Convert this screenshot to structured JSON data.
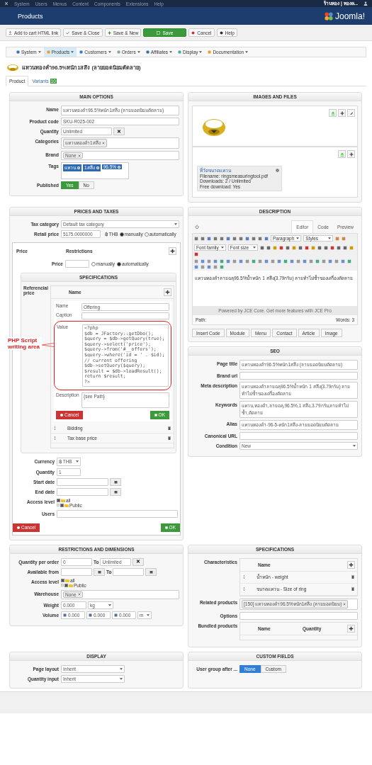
{
  "top_menu": [
    "System",
    "Users",
    "Menus",
    "Content",
    "Components",
    "Extensions",
    "Help"
  ],
  "user_menu": "ร้านทอง | ทองค...",
  "header": {
    "title": "Products",
    "logo": "Joomla!"
  },
  "toolbar": [
    {
      "label": "Add to cart HTML link",
      "kind": "default"
    },
    {
      "label": "Save & Close",
      "kind": "default"
    },
    {
      "label": "Save & New",
      "kind": "default"
    },
    {
      "label": "Save",
      "kind": "primary"
    },
    {
      "label": "Cancel",
      "kind": "default"
    },
    {
      "label": "Help",
      "kind": "default"
    }
  ],
  "component_menu": [
    {
      "label": "System",
      "selected": false
    },
    {
      "label": "Products",
      "selected": true
    },
    {
      "label": "Customers",
      "selected": false
    },
    {
      "label": "Orders",
      "selected": false
    },
    {
      "label": "Affiliates",
      "selected": false
    },
    {
      "label": "Display",
      "selected": false
    },
    {
      "label": "Documentation",
      "selected": false
    }
  ],
  "product_title": "แหวนทองคำ96.5%หนัก1สลึง (ลายยอดนิยมตัดลาย)",
  "tabs": [
    {
      "label": "Product",
      "selected": true
    },
    {
      "label": "Variants",
      "badge": "10",
      "selected": false
    }
  ],
  "rows": [
    {
      "left": [
        {
          "kind": "form",
          "title": "MAIN OPTIONS",
          "fields": [
            {
              "kind": "text",
              "label": "Name",
              "value": "แหวนทองคำ96.5%หนัก1สลึง (ลายยอดนิยมตัดลาย)"
            },
            {
              "kind": "text",
              "label": "Product code",
              "value": "SKU-R025-002"
            },
            {
              "kind": "clearable",
              "label": "Quantity",
              "value": "Unlimited",
              "button": "✕"
            },
            {
              "kind": "chips",
              "label": "Categories",
              "chips": [
                "แหวนทองคำ1สลึง"
              ]
            },
            {
              "kind": "chips",
              "label": "Brand",
              "chips": [
                "None"
              ]
            },
            {
              "kind": "tags",
              "label": "Tags",
              "chips": [
                "แหวน",
                "1สลึง",
                "96.5%"
              ]
            },
            {
              "kind": "toggle",
              "label": "Published",
              "options": [
                {
                  "label": "Yes",
                  "selected": true
                },
                {
                  "label": "No",
                  "selected": false
                }
              ]
            }
          ]
        }
      ],
      "right": [
        {
          "kind": "images",
          "title": "IMAGES AND FILES",
          "file": {
            "title": "ที่วัดขนาดแหวน",
            "lines": [
              "Filename: ringsmeasuringtool.pdf",
              "Downloads: 2 / Unlimited",
              "Free download: Yes"
            ]
          }
        }
      ]
    },
    {
      "left": [
        {
          "kind": "prices",
          "title": "PRICES AND TAXES",
          "fields": [
            {
              "kind": "select",
              "label": "Tax category",
              "value": "Default tax category"
            },
            {
              "kind": "price",
              "label": "Retail price",
              "value": "5175.0000000",
              "currency": "฿ THB",
              "options": [
                {
                  "label": "manually",
                  "selected": true
                },
                {
                  "label": "automatically",
                  "selected": false
                }
              ]
            }
          ],
          "popup": {
            "columns": [
              "Price",
              "Restrictions"
            ],
            "price_label": "Price",
            "price_options": [
              {
                "label": "manually",
                "selected": false
              },
              {
                "label": "automatically",
                "selected": true
              }
            ],
            "spec": {
              "title": "SPECIFICATIONS",
              "label": "Referencial price",
              "header": "Name",
              "name_label": "Name",
              "name_value": "Offering",
              "caption_label": "Caption",
              "value_label": "Value",
              "code": [
                "<?php",
                "$db = JFactory::getDbo();",
                "$query = $db->getQuery(true);",
                "$query->select('price');",
                "$query->from('#__offers');",
                "$query->where('id = ' . $id);",
                "// current offering",
                "$db->setQuery($query);",
                "$result = $db->loadResult();",
                "return $result;",
                "?>"
              ],
              "description_label": "Description",
              "description_value": "{see Path}",
              "cancel": "Cancel",
              "ok": "OK",
              "rows": [
                "Bidding",
                "Tax base price"
              ]
            },
            "fields": [
              {
                "kind": "select",
                "label": "Currency",
                "value": "฿ THB"
              },
              {
                "kind": "text",
                "label": "Quantity",
                "value": "1"
              },
              {
                "kind": "date",
                "label": "Start date"
              },
              {
                "kind": "date",
                "label": "End date"
              },
              {
                "kind": "access",
                "label": "Access level",
                "tree": [
                  {
                    "label": "all",
                    "checked": true,
                    "children": [
                      {
                        "label": "Public",
                        "checked": true
                      }
                    ]
                  }
                ]
              },
              {
                "kind": "text",
                "label": "Users"
              }
            ],
            "cancel": "Cancel",
            "ok": "OK"
          },
          "callout": "PHP Script writing area"
        }
      ],
      "right": [
        {
          "kind": "editor",
          "title": "DESCRIPTION",
          "tabs": [
            {
              "label": "Editor",
              "selected": true
            },
            {
              "label": "Code",
              "selected": false
            },
            {
              "label": "Preview",
              "selected": false
            }
          ],
          "selects": [
            "Paragraph",
            "Styles",
            "Font family",
            "Font size"
          ],
          "content": "แหวนทองคำลายฉลุ96.5%น้ำหนัก 1 สลึง(3.79กรัม) ลายทำไม่ซ้ำของเครื่องตัดลาย",
          "powered": "Powered by JCE Core. Get more features with JCE Pro",
          "path": "Path:",
          "words": "Words: 3",
          "buttons": [
            "Insert Code",
            "Module",
            "Menu",
            "Contact",
            "Article",
            "Image"
          ]
        },
        {
          "kind": "form",
          "title": "SEO",
          "fields": [
            {
              "kind": "text",
              "label": "Page title",
              "value": "แหวนทองคำ96.5%หนัก1สลึง (ลายยอดนิยมตัดลาย)"
            },
            {
              "kind": "text",
              "label": "Brand url"
            },
            {
              "kind": "textarea",
              "label": "Meta description",
              "value": "แหวนทองคำลายฉลุ96.5%น้ำหนัก 1 สลึง(3.79กรัม) ลายทำไม่ซ้ำของเครื่องตัดลาย"
            },
            {
              "kind": "textarea",
              "label": "Keywords",
              "value": "แหวน,ทองคำ,ลายฉลุ,96.5%,1 สลึง,3.79กรัม,ลายทำไม่ซ้ำ,ตัดลาย"
            },
            {
              "kind": "text",
              "label": "Alias",
              "value": "แหวนทองคำ-96-5-หนัก1สลึง-ลายยอดนิยมตัดลาย"
            },
            {
              "kind": "text",
              "label": "Canonical URL"
            },
            {
              "kind": "select",
              "label": "Condition",
              "value": "New"
            }
          ]
        }
      ]
    },
    {
      "left": [
        {
          "kind": "form",
          "title": "RESTRICTIONS AND DIMENSIONS",
          "fields": [
            {
              "kind": "range",
              "label": "Quantity per order",
              "from": "0",
              "to_label": "To",
              "to": "Unlimited",
              "button": "✕"
            },
            {
              "kind": "range",
              "label": "Available from",
              "to_label": "To"
            },
            {
              "kind": "access",
              "label": "Access level",
              "tree": [
                {
                  "label": "all",
                  "checked": true,
                  "children": [
                    {
                      "label": "Public",
                      "checked": true
                    }
                  ]
                }
              ]
            },
            {
              "kind": "chips",
              "label": "Warehouse",
              "chips": [
                "None"
              ]
            },
            {
              "kind": "unit",
              "label": "Weight",
              "value": "0.000",
              "unit": "kg"
            },
            {
              "kind": "volume",
              "label": "Volume",
              "values": [
                "0.000",
                "0.000",
                "0.000"
              ],
              "unit": "m"
            }
          ]
        }
      ],
      "right": [
        {
          "kind": "form",
          "title": "SPECIFICATIONS",
          "fields": [
            {
              "kind": "table",
              "label": "Characteristics",
              "columns": [
                "Name"
              ],
              "rows": [
                "น้ำหนัก - weight",
                "ขนาดแหวน - Size of ring"
              ]
            },
            {
              "kind": "chips",
              "label": "Related products",
              "chips": [
                "[150] แหวนทองคำ96.5%หนัก1สลึง (ลายยอดนิยม)"
              ]
            },
            {
              "kind": "text",
              "label": "Options"
            },
            {
              "kind": "table",
              "label": "Bundled products",
              "columns": [
                "Name",
                "Quantity"
              ]
            }
          ]
        }
      ]
    },
    {
      "left": [
        {
          "kind": "form",
          "title": "DISPLAY",
          "fields": [
            {
              "kind": "select",
              "label": "Page layout",
              "value": "Inherit"
            },
            {
              "kind": "select",
              "label": "Quantity input",
              "value": "Inherit"
            }
          ]
        }
      ],
      "right": [
        {
          "kind": "form",
          "title": "CUSTOM FIELDS",
          "fields": [
            {
              "kind": "segmented",
              "label": "User group after ...",
              "options": [
                {
                  "label": "None",
                  "selected": true
                },
                {
                  "label": "Custom",
                  "selected": false
                }
              ]
            }
          ]
        }
      ]
    }
  ]
}
